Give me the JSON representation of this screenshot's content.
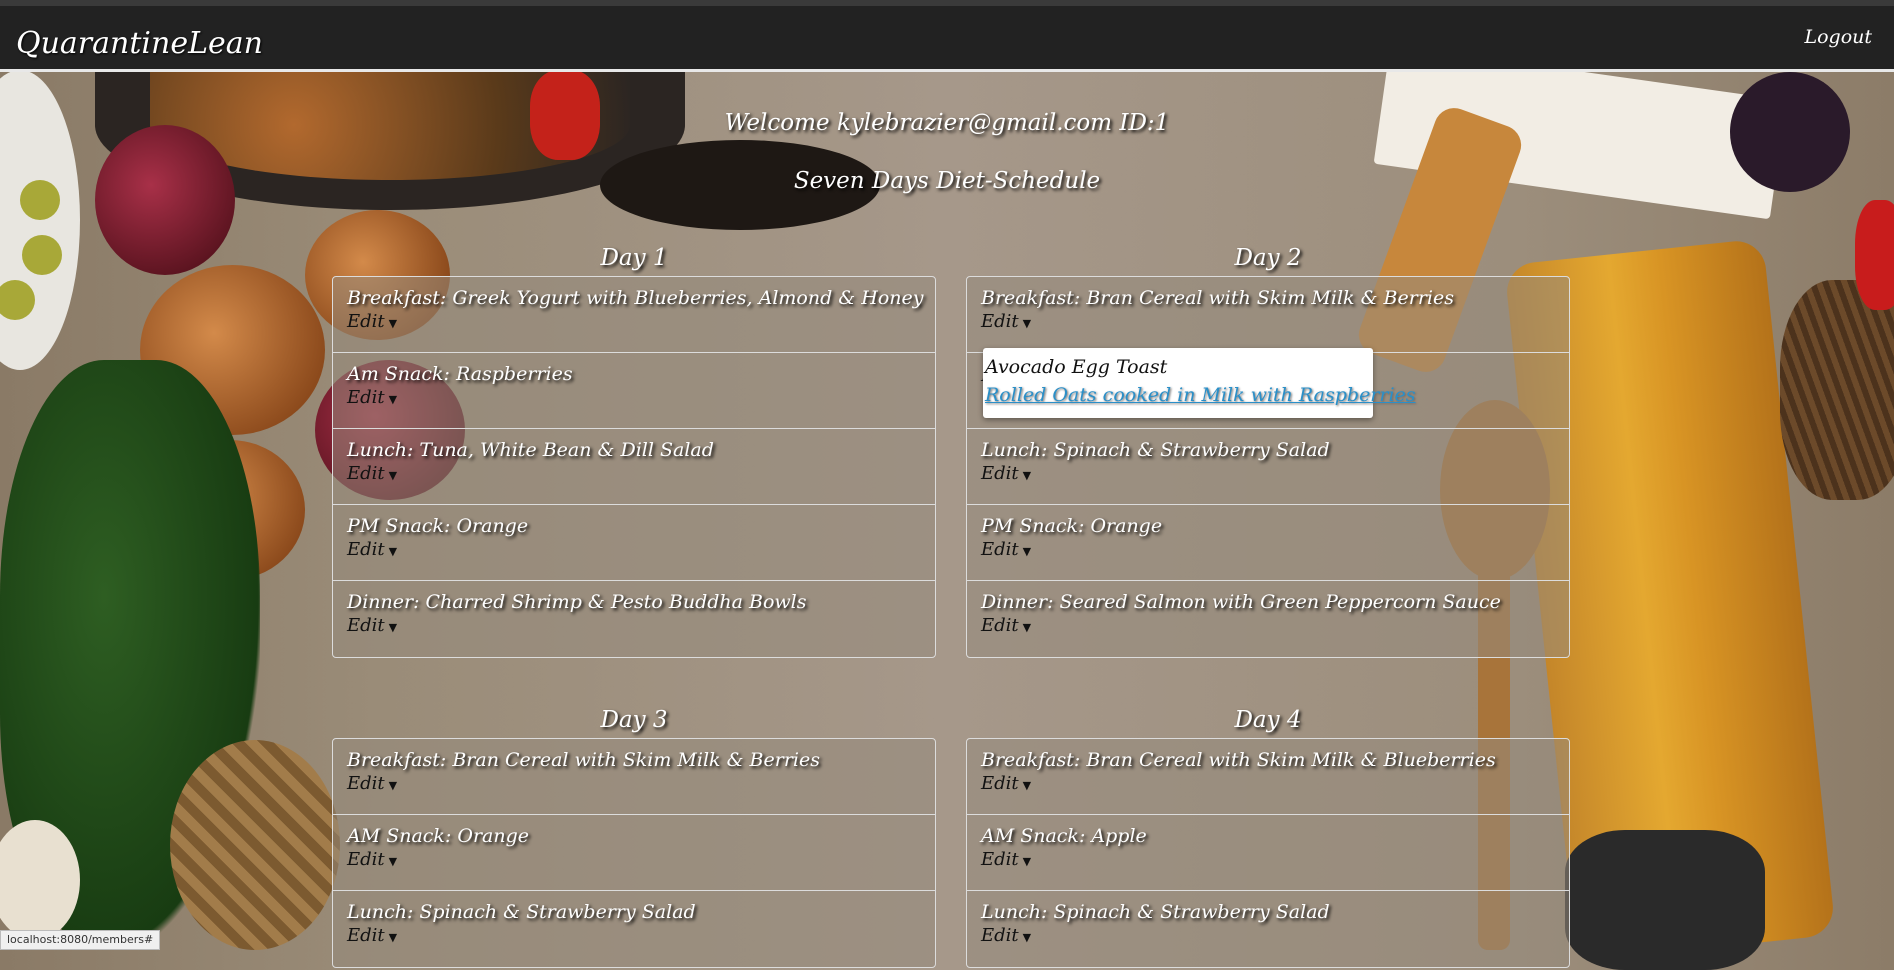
{
  "navbar": {
    "brand": "QuarantineLean",
    "logout": "Logout"
  },
  "welcome": "Welcome kylebrazier@gmail.com ID:1",
  "schedule_title": "Seven Days Diet-Schedule",
  "edit_label": "Edit",
  "days": [
    {
      "title": "Day 1",
      "meals": [
        "Breakfast: Greek Yogurt with Blueberries, Almond & Honey",
        "Am Snack: Raspberries",
        "Lunch: Tuna, White Bean & Dill Salad",
        "PM Snack: Orange",
        "Dinner: Charred Shrimp & Pesto Buddha Bowls"
      ]
    },
    {
      "title": "Day 2",
      "meals": [
        "Breakfast: Bran Cereal with Skim Milk & Berries",
        "",
        "Lunch: Spinach & Strawberry Salad",
        "PM Snack: Orange",
        "Dinner: Seared Salmon with Green Peppercorn Sauce"
      ]
    },
    {
      "title": "Day 3",
      "meals": [
        "Breakfast: Bran Cereal with Skim Milk & Berries",
        "AM Snack: Orange",
        "Lunch: Spinach & Strawberry Salad"
      ]
    },
    {
      "title": "Day 4",
      "meals": [
        "Breakfast: Bran Cereal with Skim Milk & Blueberries",
        "AM Snack: Apple",
        "Lunch: Spinach & Strawberry Salad"
      ]
    }
  ],
  "dropdown": {
    "items": [
      "Avocado Egg Toast",
      "Rolled Oats cooked in Milk with Raspberries"
    ]
  },
  "status_url": "localhost:8080/members#"
}
